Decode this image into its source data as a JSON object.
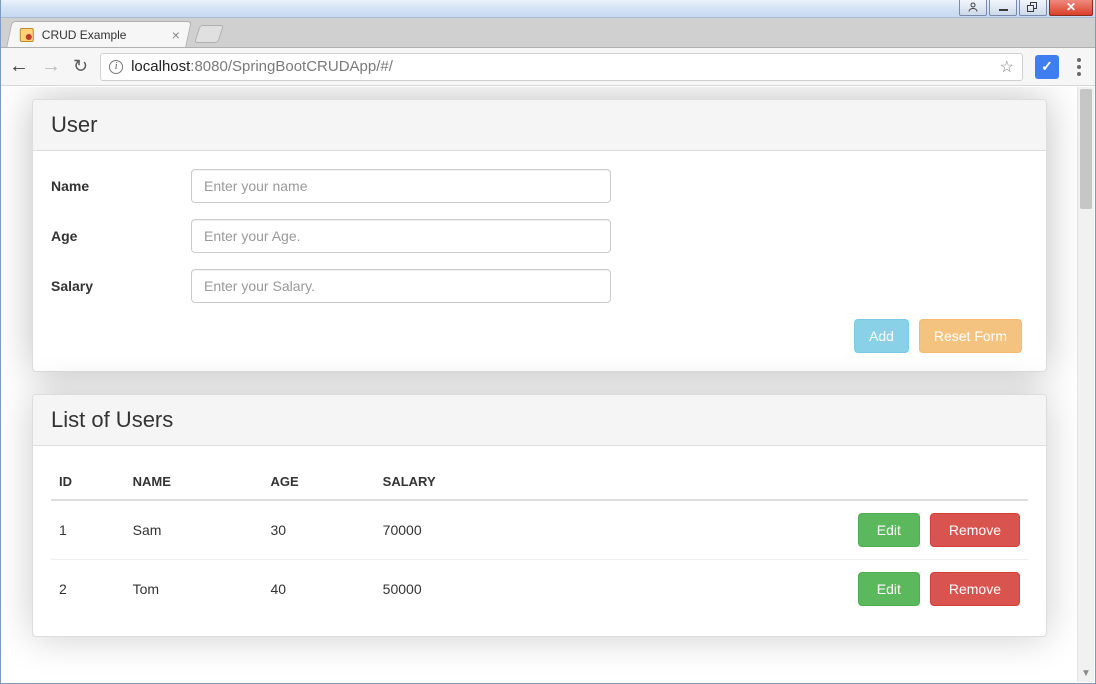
{
  "window": {
    "tab_title": "CRUD Example"
  },
  "browser": {
    "url_host": "localhost",
    "url_port_path": ":8080/SpringBootCRUDApp/#/"
  },
  "form_panel": {
    "title": "User",
    "fields": {
      "name": {
        "label": "Name",
        "placeholder": "Enter your name"
      },
      "age": {
        "label": "Age",
        "placeholder": "Enter your Age."
      },
      "salary": {
        "label": "Salary",
        "placeholder": "Enter your Salary."
      }
    },
    "actions": {
      "add": "Add",
      "reset": "Reset Form"
    }
  },
  "list_panel": {
    "title": "List of Users",
    "columns": {
      "id": "ID",
      "name": "NAME",
      "age": "AGE",
      "salary": "SALARY"
    },
    "row_actions": {
      "edit": "Edit",
      "remove": "Remove"
    },
    "rows": [
      {
        "id": "1",
        "name": "Sam",
        "age": "30",
        "salary": "70000"
      },
      {
        "id": "2",
        "name": "Tom",
        "age": "40",
        "salary": "50000"
      }
    ]
  }
}
